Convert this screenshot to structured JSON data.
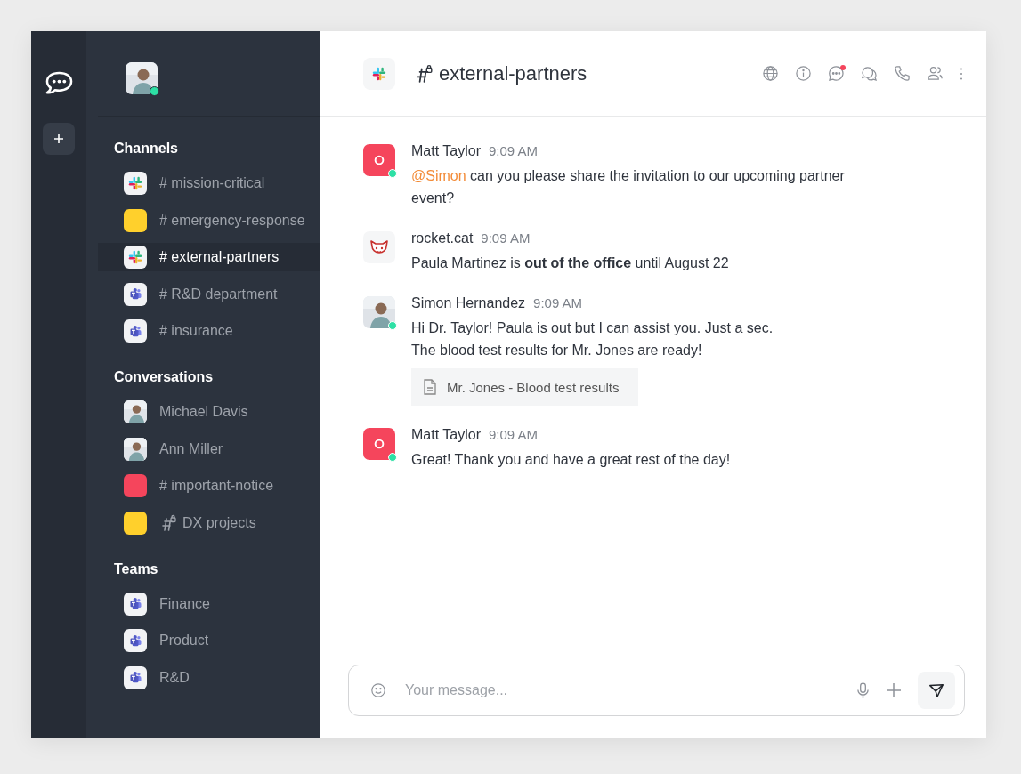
{
  "user": {
    "online": true
  },
  "sidebar": {
    "sections": [
      {
        "title": "Channels",
        "items": [
          {
            "label": "# mission-critical",
            "kind": "slack",
            "private": false,
            "selected": false
          },
          {
            "label": "# emergency-response",
            "kind": "color",
            "color": "#ffd02c",
            "private": false,
            "selected": false
          },
          {
            "label": "# external-partners",
            "kind": "slack",
            "private": false,
            "selected": true
          },
          {
            "label": "# R&D department",
            "kind": "teams",
            "private": false,
            "selected": false
          },
          {
            "label": "# insurance",
            "kind": "teams",
            "private": false,
            "selected": false
          }
        ]
      },
      {
        "title": "Conversations",
        "items": [
          {
            "label": "Michael Davis",
            "kind": "avatar",
            "private": false,
            "selected": false
          },
          {
            "label": "Ann Miller",
            "kind": "avatar",
            "private": false,
            "selected": false
          },
          {
            "label": "# important-notice",
            "kind": "color",
            "color": "#f5455c",
            "private": false,
            "selected": false
          },
          {
            "label": "DX projects",
            "kind": "color",
            "color": "#ffd02c",
            "private": true,
            "selected": false
          }
        ]
      },
      {
        "title": "Teams",
        "items": [
          {
            "label": "Finance",
            "kind": "teams",
            "private": false,
            "selected": false
          },
          {
            "label": "Product",
            "kind": "teams",
            "private": false,
            "selected": false
          },
          {
            "label": "R&D",
            "kind": "teams",
            "private": false,
            "selected": false
          }
        ]
      }
    ]
  },
  "header": {
    "title": "external-partners",
    "kind": "slack",
    "private": true,
    "actions": [
      {
        "kind": "globe",
        "badge": false
      },
      {
        "kind": "info",
        "badge": false
      },
      {
        "kind": "discussion",
        "badge": true
      },
      {
        "kind": "threads",
        "badge": false
      },
      {
        "kind": "phone",
        "badge": false
      },
      {
        "kind": "members",
        "badge": false
      },
      {
        "kind": "kebab",
        "badge": false
      }
    ]
  },
  "messages": [
    {
      "author": "Matt Taylor",
      "time": "9:09 AM",
      "avatar": {
        "kind": "tile"
      },
      "online": true,
      "mention": "@Simon",
      "paragraphs": [
        "can you please share the invitation to our upcoming partner event?"
      ]
    },
    {
      "author": "rocket.cat",
      "time": "9:09 AM",
      "avatar": {
        "kind": "bot"
      },
      "online": false,
      "paragraphs": [
        "Paula Martinez is **out of the office** until August 22"
      ]
    },
    {
      "author": "Simon Hernandez",
      "time": "9:09 AM",
      "avatar": {
        "kind": "photo"
      },
      "online": true,
      "paragraphs": [
        "Hi Dr. Taylor! Paula is out but I can assist you. Just a sec.",
        "The blood test results for Mr. Jones are ready!"
      ],
      "attachment": "Mr. Jones - Blood test results"
    },
    {
      "author": "Matt Taylor",
      "time": "9:09 AM",
      "avatar": {
        "kind": "tile"
      },
      "online": true,
      "paragraphs": [
        "Great! Thank you and have a great rest of the day!"
      ]
    }
  ],
  "composer": {
    "placeholder": "Your message..."
  }
}
